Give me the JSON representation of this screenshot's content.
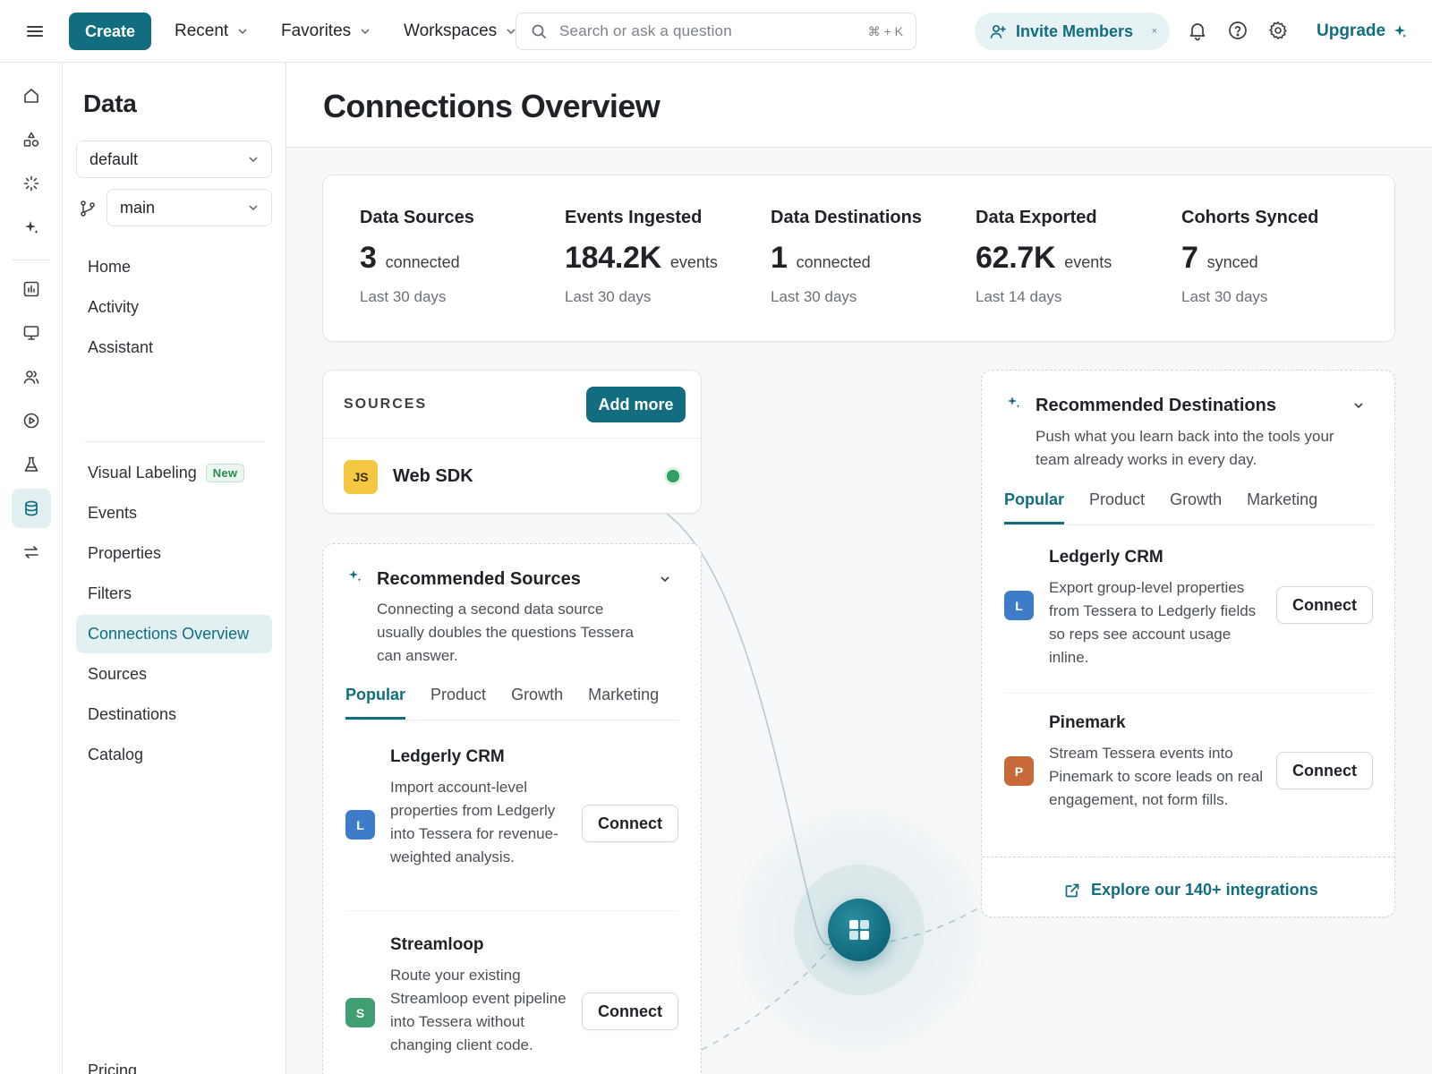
{
  "topbar": {
    "create_label": "Create",
    "nav": [
      {
        "label": "Recent"
      },
      {
        "label": "Favorites"
      },
      {
        "label": "Workspaces"
      }
    ],
    "search_placeholder": "Search or ask a question",
    "search_shortcut": "⌘ + K",
    "invite_label": "Invite Members",
    "invite_close": "×",
    "upgrade_label": "Upgrade"
  },
  "sidebar": {
    "title": "Data",
    "project_select": "default",
    "branch_select": "main",
    "items": [
      {
        "label": "Home"
      },
      {
        "label": "Activity"
      },
      {
        "label": "Assistant"
      },
      {
        "label": "Visual Labeling",
        "badge": "New"
      },
      {
        "label": "Events"
      },
      {
        "label": "Properties"
      },
      {
        "label": "Filters"
      },
      {
        "label": "Connections Overview",
        "active": true
      },
      {
        "label": "Sources"
      },
      {
        "label": "Destinations"
      },
      {
        "label": "Catalog"
      },
      {
        "label": "Pricing"
      }
    ]
  },
  "page": {
    "title": "Connections Overview"
  },
  "stats": [
    {
      "label": "Data Sources",
      "value": "3",
      "unit": "connected",
      "period": "Last 30 days"
    },
    {
      "label": "Events Ingested",
      "value": "184.2K",
      "unit": "events",
      "period": "Last 30 days"
    },
    {
      "label": "Data Destinations",
      "value": "1",
      "unit": "connected",
      "period": "Last 30 days"
    },
    {
      "label": "Data Exported",
      "value": "62.7K",
      "unit": "events",
      "period": "Last 14 days"
    },
    {
      "label": "Cohorts Synced",
      "value": "7",
      "unit": "synced",
      "period": "Last 30 days"
    }
  ],
  "sources": {
    "header": "SOURCES",
    "add_label": "Add more",
    "items": [
      {
        "badge": "JS",
        "name": "Web SDK",
        "status_color": "#2f9e63"
      }
    ]
  },
  "recommended_sources": {
    "title": "Recommended Sources",
    "description": "Connecting a second data source usually doubles the questions Tessera can answer.",
    "tabs": [
      "Popular",
      "Product",
      "Growth",
      "Marketing"
    ],
    "items": [
      {
        "badge": "L",
        "badge_color": "#3d7cc9",
        "name": "Ledgerly CRM",
        "description": "Import account-level properties from Ledgerly into Tessera for revenue-weighted analysis.",
        "action": "Connect"
      },
      {
        "badge": "S",
        "badge_color": "#3f9e72",
        "name": "Streamloop",
        "description": "Route your existing Streamloop event pipeline into Tessera without changing client code.",
        "action": "Connect"
      }
    ]
  },
  "recommended_destinations": {
    "title": "Recommended Destinations",
    "description": "Push what you learn back into the tools your team already works in every day.",
    "tabs": [
      "Popular",
      "Product",
      "Growth",
      "Marketing"
    ],
    "items": [
      {
        "badge": "L",
        "badge_color": "#3d7cc9",
        "name": "Ledgerly CRM",
        "description": "Export group-level properties from Tessera to Ledgerly fields so reps see account usage inline.",
        "action": "Connect"
      },
      {
        "badge": "P",
        "badge_color": "#c8693a",
        "name": "Pinemark",
        "description": "Stream Tessera events into Pinemark to score leads on real engagement, not form fills.",
        "action": "Connect"
      }
    ],
    "explore_label": "Explore our 140+ integrations"
  },
  "colors": {
    "accent": "#126d80",
    "accent_light": "#e3f0f2",
    "success": "#2f9e63"
  }
}
